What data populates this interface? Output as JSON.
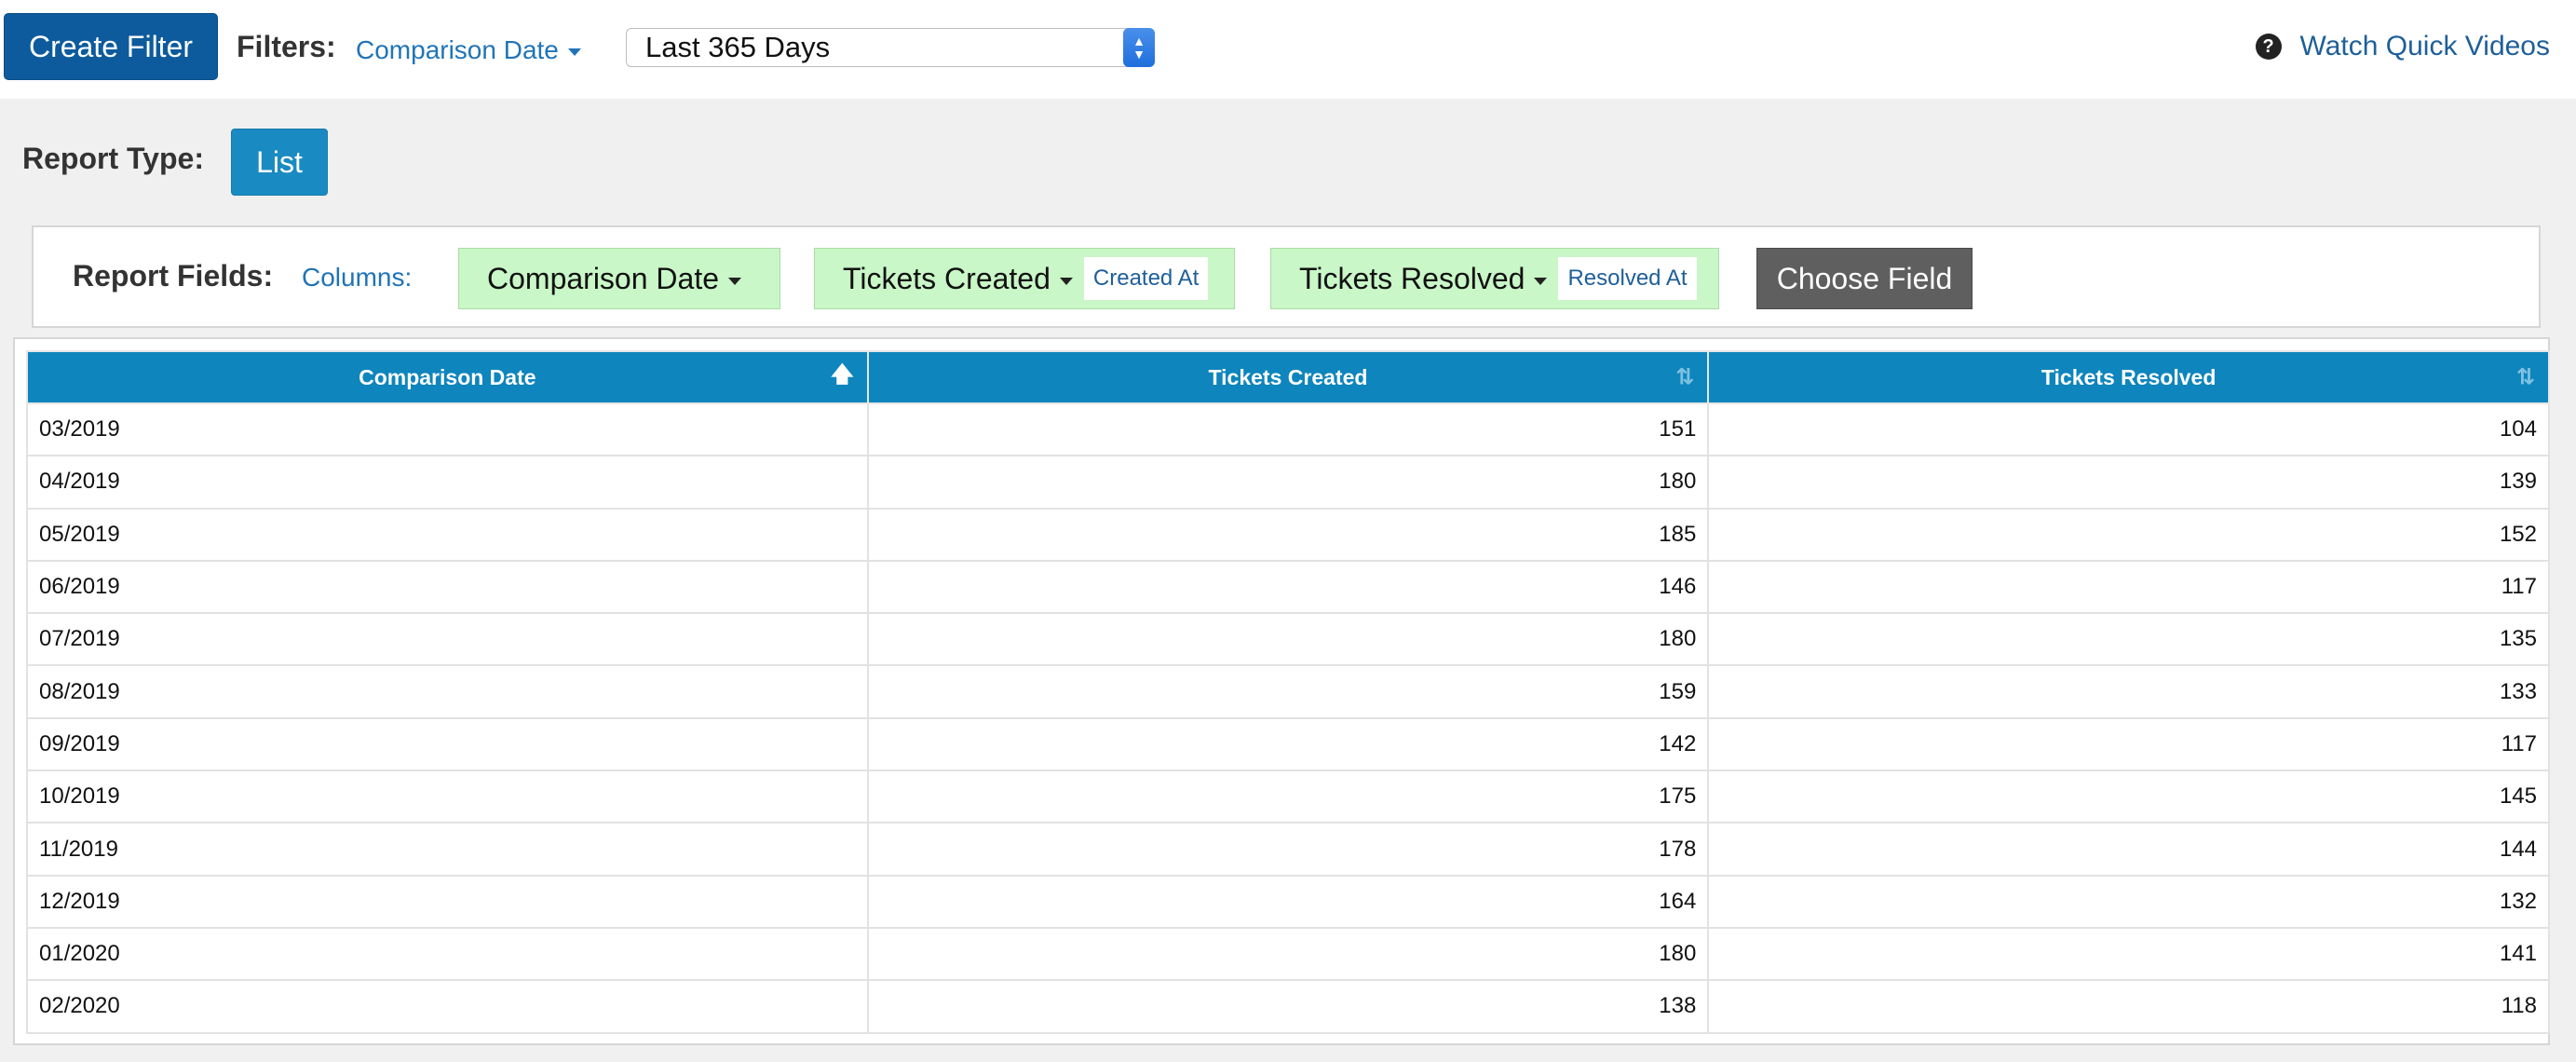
{
  "toolbar": {
    "create_filter_label": "Create Filter",
    "filters_label": "Filters:",
    "filter_field": "Comparison Date",
    "period_value": "Last 365 Days",
    "quick_videos_label": "Watch Quick Videos"
  },
  "report_type": {
    "label": "Report Type:",
    "value": "List"
  },
  "report_fields": {
    "label": "Report Fields:",
    "columns_label": "Columns:",
    "fields": [
      {
        "name": "Comparison Date",
        "tag": ""
      },
      {
        "name": "Tickets Created",
        "tag": "Created At"
      },
      {
        "name": "Tickets Resolved",
        "tag": "Resolved At"
      }
    ],
    "choose_field_label": "Choose Field"
  },
  "table": {
    "headers": [
      "Comparison Date",
      "Tickets Created",
      "Tickets Resolved"
    ],
    "rows": [
      [
        "03/2019",
        "151",
        "104"
      ],
      [
        "04/2019",
        "180",
        "139"
      ],
      [
        "05/2019",
        "185",
        "152"
      ],
      [
        "06/2019",
        "146",
        "117"
      ],
      [
        "07/2019",
        "180",
        "135"
      ],
      [
        "08/2019",
        "159",
        "133"
      ],
      [
        "09/2019",
        "142",
        "117"
      ],
      [
        "10/2019",
        "175",
        "145"
      ],
      [
        "11/2019",
        "178",
        "144"
      ],
      [
        "12/2019",
        "164",
        "132"
      ],
      [
        "01/2020",
        "180",
        "141"
      ],
      [
        "02/2020",
        "138",
        "118"
      ]
    ]
  },
  "colors": {
    "primary": "#0d5b9c",
    "table_header": "#0e85bd",
    "field_chip": "#c9f7c7",
    "link": "#1f74b8"
  },
  "icons": {
    "help": "question-circle-icon",
    "sort_active": "arrow-up-icon",
    "sort_inactive": "sort-icon"
  }
}
